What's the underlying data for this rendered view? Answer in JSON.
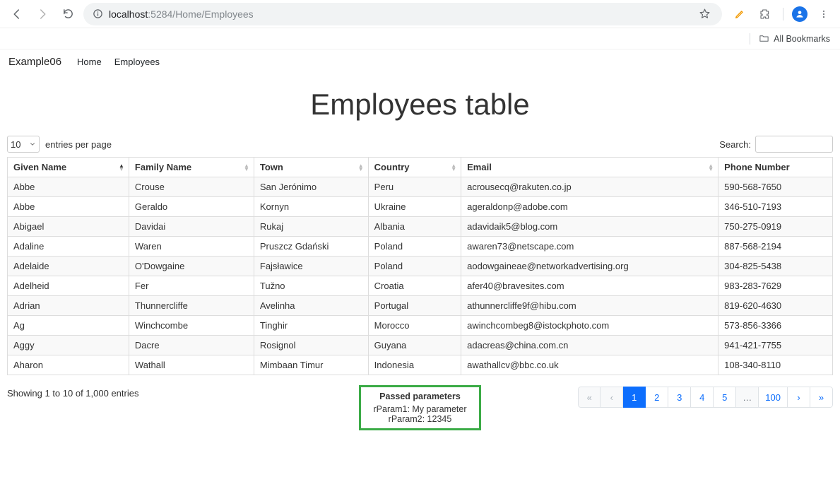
{
  "chrome": {
    "url_host": "localhost",
    "url_port_path": ":5284/Home/Employees",
    "bookmarks_label": "All Bookmarks"
  },
  "nav": {
    "brand": "Example06",
    "links": [
      "Home",
      "Employees"
    ]
  },
  "page": {
    "title": "Employees table"
  },
  "table": {
    "entries_value": "10",
    "entries_label": "entries per page",
    "search_label": "Search:",
    "columns": [
      "Given Name",
      "Family Name",
      "Town",
      "Country",
      "Email",
      "Phone Number"
    ],
    "sort_column_index": 0,
    "rows": [
      {
        "given": "Abbe",
        "family": "Crouse",
        "town": "San Jerónimo",
        "country": "Peru",
        "email": "acrousecq@rakuten.co.jp",
        "phone": "590-568-7650"
      },
      {
        "given": "Abbe",
        "family": "Geraldo",
        "town": "Kornyn",
        "country": "Ukraine",
        "email": "ageraldonp@adobe.com",
        "phone": "346-510-7193"
      },
      {
        "given": "Abigael",
        "family": "Davidai",
        "town": "Rukaj",
        "country": "Albania",
        "email": "adavidaik5@blog.com",
        "phone": "750-275-0919"
      },
      {
        "given": "Adaline",
        "family": "Waren",
        "town": "Pruszcz Gdański",
        "country": "Poland",
        "email": "awaren73@netscape.com",
        "phone": "887-568-2194"
      },
      {
        "given": "Adelaide",
        "family": "O'Dowgaine",
        "town": "Fajsławice",
        "country": "Poland",
        "email": "aodowgaineae@networkadvertising.org",
        "phone": "304-825-5438"
      },
      {
        "given": "Adelheid",
        "family": "Fer",
        "town": "Tužno",
        "country": "Croatia",
        "email": "afer40@bravesites.com",
        "phone": "983-283-7629"
      },
      {
        "given": "Adrian",
        "family": "Thunnercliffe",
        "town": "Avelinha",
        "country": "Portugal",
        "email": "athunnercliffe9f@hibu.com",
        "phone": "819-620-4630"
      },
      {
        "given": "Ag",
        "family": "Winchcombe",
        "town": "Tinghir",
        "country": "Morocco",
        "email": "awinchcombeg8@istockphoto.com",
        "phone": "573-856-3366"
      },
      {
        "given": "Aggy",
        "family": "Dacre",
        "town": "Rosignol",
        "country": "Guyana",
        "email": "adacreas@china.com.cn",
        "phone": "941-421-7755"
      },
      {
        "given": "Aharon",
        "family": "Wathall",
        "town": "Mimbaan Timur",
        "country": "Indonesia",
        "email": "awathallcv@bbc.co.uk",
        "phone": "108-340-8110"
      }
    ],
    "info_text": "Showing 1 to 10 of 1,000 entries",
    "pages": [
      "«",
      "‹",
      "1",
      "2",
      "3",
      "4",
      "5",
      "…",
      "100",
      "›",
      "»"
    ],
    "active_page_index": 2
  },
  "params": {
    "title": "Passed parameters",
    "line1": "rParam1: My parameter",
    "line2": "rParam2: 12345"
  }
}
